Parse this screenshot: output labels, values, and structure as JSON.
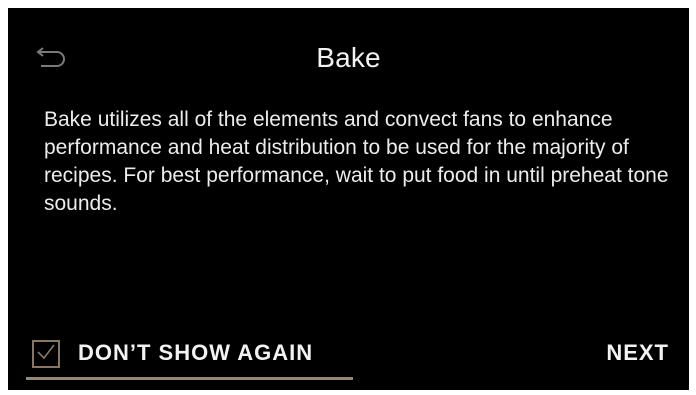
{
  "header": {
    "title": "Bake",
    "back_icon": "back-arrow-icon"
  },
  "body": {
    "description": "Bake utilizes all of the elements and convect fans to enhance performance and heat distribution to be used for the majority of recipes. For best performance, wait to put food in until preheat tone sounds."
  },
  "footer": {
    "dont_show_again": {
      "label": "DON’T SHOW AGAIN",
      "checked": true,
      "icon": "checkmark-icon"
    },
    "next_label": "NEXT"
  },
  "colors": {
    "background": "#000000",
    "text": "#f2f2f2",
    "accent": "#9a8771"
  }
}
